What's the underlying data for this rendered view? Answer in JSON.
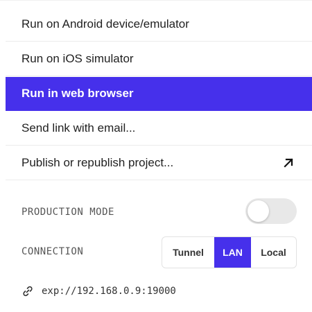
{
  "menu": {
    "items": [
      {
        "label": "Run on Android device/emulator"
      },
      {
        "label": "Run on iOS simulator"
      },
      {
        "label": "Run in web browser"
      },
      {
        "label": "Send link with email..."
      },
      {
        "label": "Publish or republish project..."
      }
    ],
    "active_index": 2,
    "publish_icon": "arrow-up-right-icon"
  },
  "settings": {
    "production_mode": {
      "label": "PRODUCTION MODE",
      "enabled": false
    },
    "connection": {
      "label": "CONNECTION",
      "options": [
        "Tunnel",
        "LAN",
        "Local"
      ],
      "selected": "LAN"
    }
  },
  "url": {
    "icon": "link-icon",
    "value": "exp://192.168.0.9:19000"
  },
  "colors": {
    "accent": "#4630eb",
    "toggle_off": "#e8e8e8",
    "text": "#1f1f1f"
  }
}
